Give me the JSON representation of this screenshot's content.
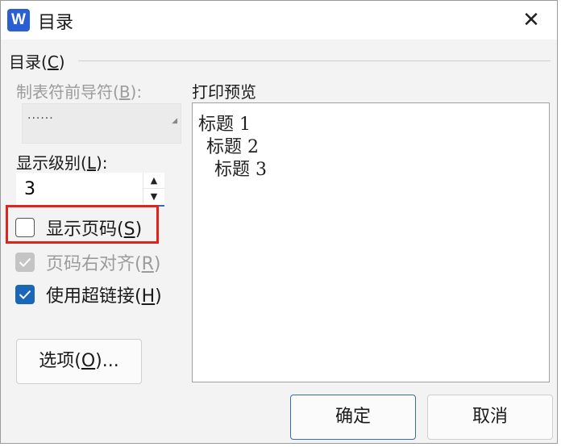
{
  "window": {
    "app_icon_letter": "W",
    "title": "目录",
    "close_glyph": "✕"
  },
  "group": {
    "title": "目录(",
    "title_key": "C",
    "title_end": ")"
  },
  "tab_leader": {
    "label": "制表符前导符(",
    "label_key": "B",
    "label_end": "):",
    "value": "......",
    "enabled": false
  },
  "show_levels": {
    "label": "显示级别(",
    "label_key": "L",
    "label_end": "):",
    "value": "3"
  },
  "options": [
    {
      "label": "显示页码(",
      "key": "S",
      "end": ")",
      "checked": false,
      "enabled": true
    },
    {
      "label": "页码右对齐(",
      "key": "R",
      "end": ")",
      "checked": true,
      "enabled": false
    },
    {
      "label": "使用超链接(",
      "key": "H",
      "end": ")",
      "checked": true,
      "enabled": true
    }
  ],
  "options_button": {
    "label": "选项(",
    "key": "O",
    "end": ")..."
  },
  "preview": {
    "title": "打印预览",
    "entries": [
      "标题 1",
      "标题 2",
      "标题 3"
    ]
  },
  "buttons": {
    "ok": "确定",
    "cancel": "取消"
  },
  "colors": {
    "accent": "#1a66b8",
    "highlight": "#e0241c",
    "app_icon": "#2b5fd1"
  }
}
